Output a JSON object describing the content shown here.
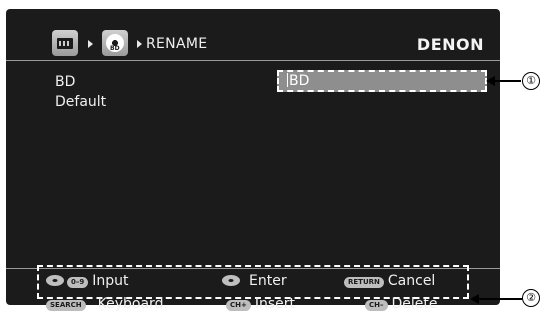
{
  "header": {
    "breadcrumb_title": "RENAME",
    "brand": "DENON",
    "icons": [
      "setup-film-icon",
      "bd-disc-icon"
    ],
    "bd_icon_tag": "BD"
  },
  "sources": {
    "items": [
      {
        "label": "BD"
      },
      {
        "label": "Default"
      }
    ]
  },
  "name_field": {
    "value": "BD"
  },
  "guide": {
    "row1": [
      {
        "key": "0–9",
        "label": "Input"
      },
      {
        "label": "Enter"
      },
      {
        "key": "RETURN",
        "label": "Cancel"
      }
    ],
    "row2": [
      {
        "key": "SEARCH",
        "label": "Keyboard"
      },
      {
        "key": "CH+",
        "label": "Insert"
      },
      {
        "key": "CH–",
        "label": "Delete"
      }
    ]
  },
  "callouts": [
    "①",
    "②"
  ],
  "colors": {
    "screen_bg": "#1b1b1b",
    "field_bg": "#8e8e8e",
    "text": "#f0f0f0"
  }
}
